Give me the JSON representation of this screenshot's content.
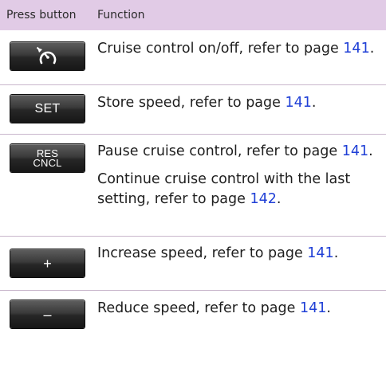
{
  "header": {
    "col_button": "Press button",
    "col_function": "Function"
  },
  "rows": [
    {
      "key": {
        "label": "",
        "icon": "cruise-control-icon"
      },
      "lines": [
        {
          "pre": "Cruise control on/off, refer to page ",
          "page": "141",
          "post": "."
        }
      ]
    },
    {
      "key": {
        "label": "SET"
      },
      "lines": [
        {
          "pre": "Store speed, refer to page ",
          "page": "141",
          "post": "."
        }
      ]
    },
    {
      "key": {
        "label_top": "RES",
        "label_bottom": "CNCL"
      },
      "lines": [
        {
          "pre": "Pause cruise control, refer to page ",
          "page": "141",
          "post": "."
        },
        {
          "pre": "Continue cruise control with the last setting, refer to page ",
          "page": "142",
          "post": "."
        }
      ]
    },
    {
      "key": {
        "label": "+"
      },
      "lines": [
        {
          "pre": "Increase speed, refer to page ",
          "page": "141",
          "post": "."
        }
      ]
    },
    {
      "key": {
        "label": "–"
      },
      "lines": [
        {
          "pre": "Reduce speed, refer to page ",
          "page": "141",
          "post": "."
        }
      ]
    }
  ]
}
